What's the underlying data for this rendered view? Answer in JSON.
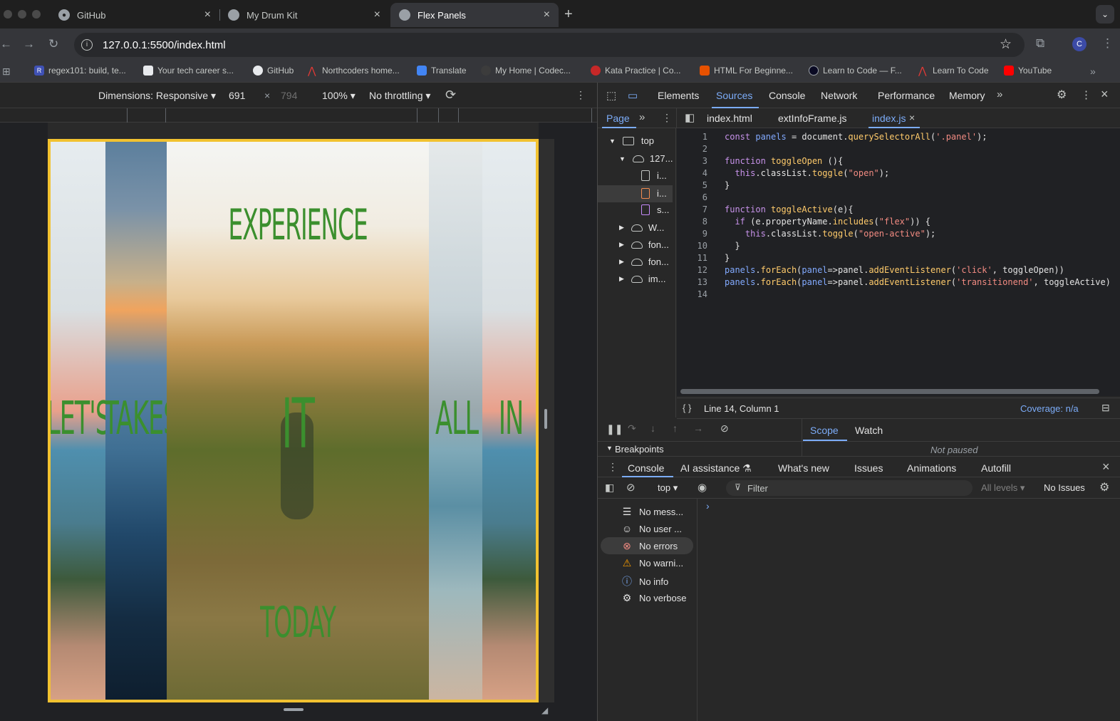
{
  "tabs": [
    {
      "title": "GitHub"
    },
    {
      "title": "My Drum Kit"
    },
    {
      "title": "Flex Panels"
    }
  ],
  "address": {
    "url": "127.0.0.1:5500/index.html",
    "avatar": "C"
  },
  "bookmarks": [
    {
      "label": "regex101: build, te...",
      "color": "#3f51b5",
      "icon": "R"
    },
    {
      "label": "Your tech career s...",
      "color": "#e8eaed",
      "icon": "A"
    },
    {
      "label": "GitHub",
      "color": "#e8eaed",
      "icon": "github-icon"
    },
    {
      "label": "Northcoders home...",
      "color": "#e53935",
      "icon": "chevron"
    },
    {
      "label": "Translate",
      "color": "#4285f4",
      "icon": "translate-icon"
    },
    {
      "label": "My Home | Codec...",
      "color": "#202124",
      "icon": "dot"
    },
    {
      "label": "Kata Practice | Co...",
      "color": "#c62828",
      "icon": "codewars"
    },
    {
      "label": "HTML For Beginne...",
      "color": "#e65100",
      "icon": "H"
    },
    {
      "label": "Learn to Code — F...",
      "color": "#0a0a23",
      "icon": "fcc"
    },
    {
      "label": "Learn To Code",
      "color": "#e53935",
      "icon": "chevron"
    },
    {
      "label": "YouTube",
      "color": "#ff0000",
      "icon": "youtube-icon"
    }
  ],
  "device_toolbar": {
    "dimensions": "Dimensions: Responsive",
    "width": "691",
    "height": "794",
    "times": "×",
    "zoom": "100%",
    "throttle": "No throttling"
  },
  "panels": [
    {
      "text": "LET'S",
      "image": "shore"
    },
    {
      "text": "TAKES",
      "image": "sunset"
    },
    {
      "top": "EXPERIENCE",
      "middle": "IT",
      "bottom": "TODAY",
      "image": "mountain ridge hiker"
    },
    {
      "text": "ALL",
      "image": "ocean"
    },
    {
      "text": "IN",
      "image": "shore"
    }
  ],
  "devtools": {
    "tabs": [
      "Elements",
      "Sources",
      "Console",
      "Network",
      "Performance",
      "Memory"
    ],
    "active_tab": "Sources",
    "navigator_tab": "Page",
    "file_tabs": [
      "index.html",
      "extInfoFrame.js",
      "index.js"
    ],
    "active_file": "index.js",
    "tree": [
      {
        "label": "top",
        "level": 0
      },
      {
        "label": "127...",
        "level": 1
      },
      {
        "label": "i...",
        "level": 2
      },
      {
        "label": "i...",
        "level": 2
      },
      {
        "label": "s...",
        "level": 2
      },
      {
        "label": "W...",
        "level": 1
      },
      {
        "label": "fon...",
        "level": 1
      },
      {
        "label": "fon...",
        "level": 1
      },
      {
        "label": "im...",
        "level": 1
      }
    ],
    "line_numbers": [
      "1",
      "2",
      "3",
      "4",
      "5",
      "6",
      "7",
      "8",
      "9",
      "10",
      "11",
      "12",
      "13",
      "14"
    ],
    "status_position": "Line 14, Column 1",
    "coverage": "Coverage: n/a",
    "scope_tabs": [
      "Scope",
      "Watch"
    ],
    "breakpoints": "Breakpoints",
    "not_paused": "Not paused",
    "drawer_tabs": [
      "Console",
      "AI assistance",
      "What's new",
      "Issues",
      "Animations",
      "Autofill"
    ],
    "console_context": "top",
    "filter_placeholder": "Filter",
    "levels": "All levels",
    "issues": "No Issues",
    "sidebar": [
      {
        "label": "No mess...",
        "icon": "list-icon"
      },
      {
        "label": "No user ...",
        "icon": "user-icon"
      },
      {
        "label": "No errors",
        "icon": "error-icon"
      },
      {
        "label": "No warni...",
        "icon": "warning-icon"
      },
      {
        "label": "No info",
        "icon": "info-icon"
      },
      {
        "label": "No verbose",
        "icon": "verbose-icon"
      }
    ],
    "prompt": "›"
  }
}
